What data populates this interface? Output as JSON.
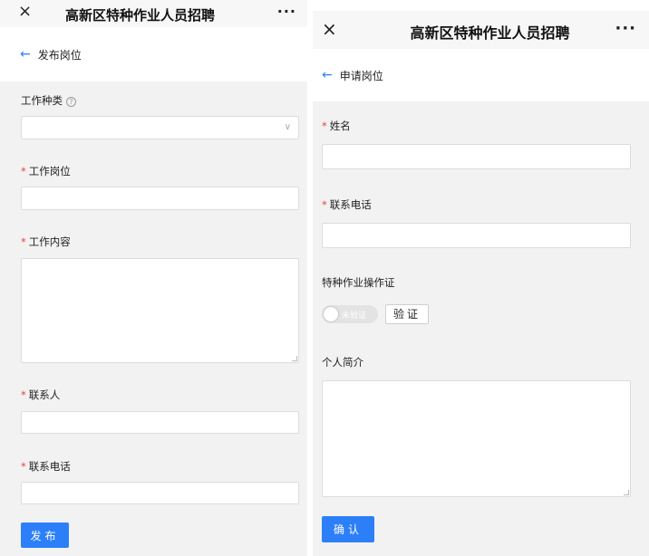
{
  "left": {
    "window_title": "高新区特种作业人员招聘",
    "close_glyph": "×",
    "more_glyph": "···",
    "back_glyph": "←",
    "header_title": "发布岗位",
    "required_mark": "*",
    "help_glyph": "?",
    "fields": {
      "work_type_label": "工作种类",
      "work_type_value": "",
      "job_position_label": "工作岗位",
      "job_position_value": "",
      "job_content_label": "工作内容",
      "job_content_value": "",
      "contact_person_label": "联系人",
      "contact_person_value": "",
      "contact_phone_label": "联系电话",
      "contact_phone_value": ""
    },
    "submit_label": "发布"
  },
  "right": {
    "window_title": "高新区特种作业人员招聘",
    "close_glyph": "×",
    "more_glyph": "···",
    "back_glyph": "←",
    "header_title": "申请岗位",
    "required_mark": "*",
    "fields": {
      "name_label": "姓名",
      "name_value": "",
      "phone_label": "联系电话",
      "phone_value": "",
      "certificate_label": "特种作业操作证",
      "certificate_status": "未验证",
      "verify_label": "验证",
      "intro_label": "个人简介",
      "intro_value": ""
    },
    "confirm_label": "确认"
  },
  "colors": {
    "accent": "#2d7ff9",
    "required": "#e64340",
    "background": "#f2f2f2"
  }
}
